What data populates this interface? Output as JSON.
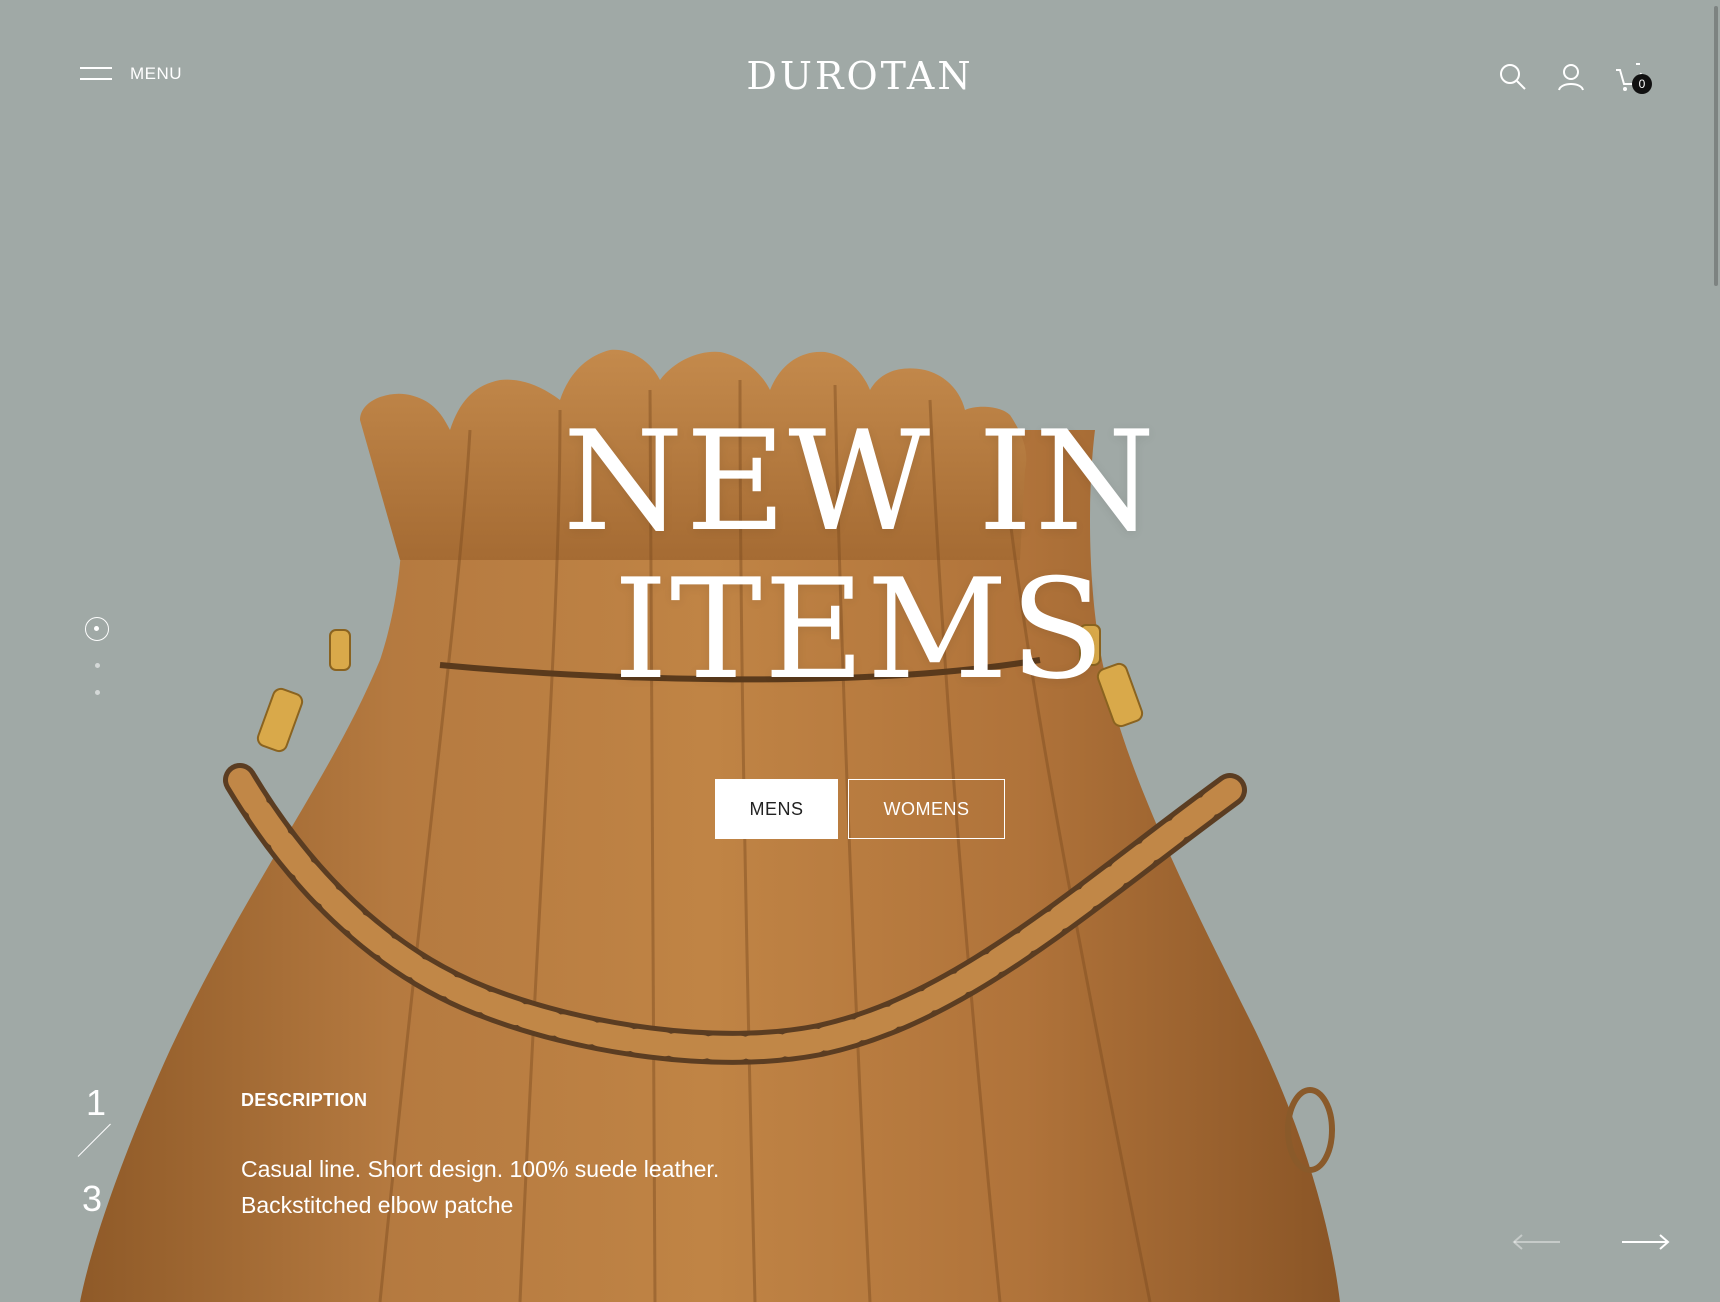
{
  "brand": {
    "logo": "DUROTAN"
  },
  "header": {
    "menu_label": "MENU",
    "icons": [
      "menu-icon",
      "search-icon",
      "user-icon",
      "cart-icon"
    ],
    "cart_count": "0"
  },
  "hero": {
    "headline_line1": "NEW IN",
    "headline_line2": "ITEMS",
    "buttons": {
      "mens": "MENS",
      "womens": "WOMENS"
    },
    "slide_current": "1",
    "slide_total": "3",
    "description_title": "DESCRIPTION",
    "description_line1": "Casual line. Short design. 100% suede leather.",
    "description_line2": "Backstitched elbow patche"
  },
  "colors": {
    "background": "#a0a9a6",
    "bag": "#b77a3e",
    "text": "#ffffff",
    "badge": "#111111"
  }
}
